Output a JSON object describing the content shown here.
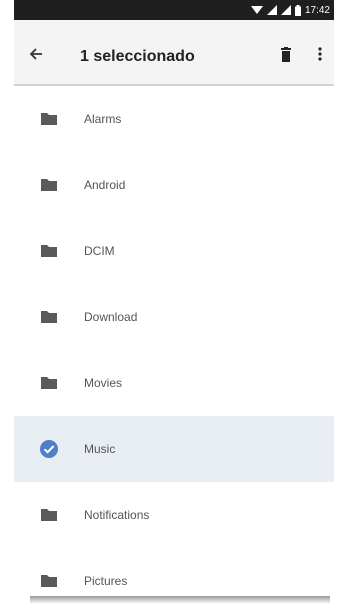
{
  "status_bar": {
    "time": "17:42"
  },
  "app_bar": {
    "title": "1 seleccionado"
  },
  "folders": [
    {
      "label": "Alarms",
      "selected": false
    },
    {
      "label": "Android",
      "selected": false
    },
    {
      "label": "DCIM",
      "selected": false
    },
    {
      "label": "Download",
      "selected": false
    },
    {
      "label": "Movies",
      "selected": false
    },
    {
      "label": "Music",
      "selected": true
    },
    {
      "label": "Notifications",
      "selected": false
    },
    {
      "label": "Pictures",
      "selected": false
    }
  ],
  "colors": {
    "status_bar": "#1f1f1f",
    "app_bar": "#f4f4f4",
    "selected_row": "#e9edf4",
    "check_accent": "#4f7fc8",
    "folder_icon": "#5a5a5a"
  },
  "icons": {
    "back": "arrow-left-icon",
    "delete": "trash-icon",
    "more": "more-vertical-icon",
    "folder": "folder-icon",
    "selected": "check-circle-icon"
  }
}
